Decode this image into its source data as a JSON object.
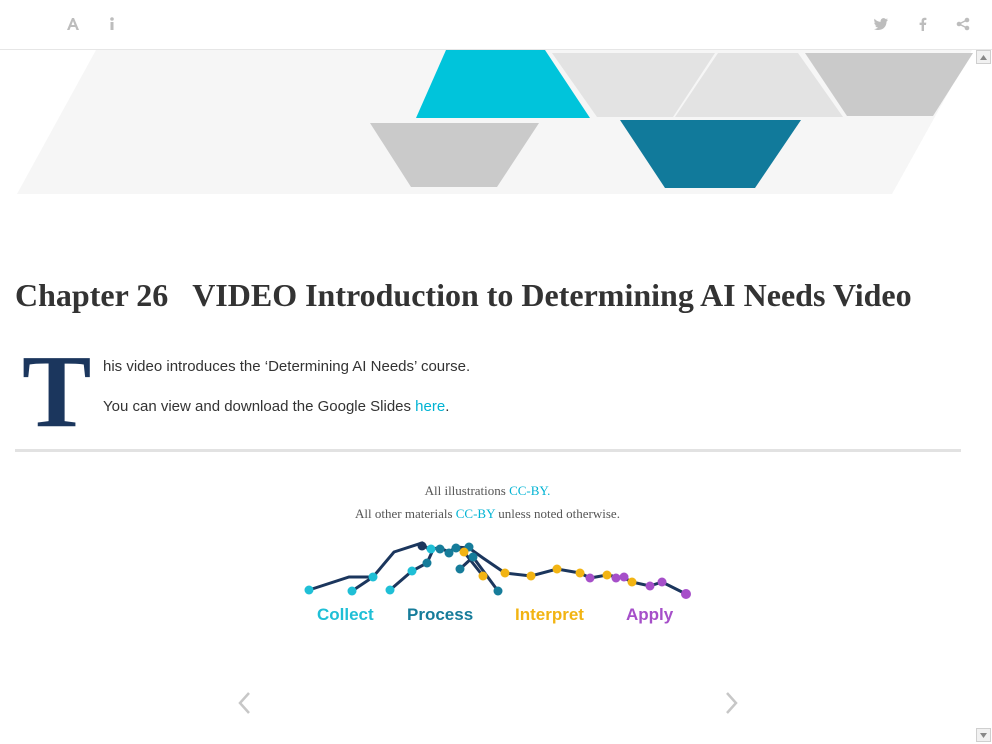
{
  "toolbar": {
    "left_icons": [
      "font-settings-icon",
      "info-icon"
    ],
    "right_icons": [
      "twitter-icon",
      "facebook-icon",
      "share-icon"
    ]
  },
  "chapter": {
    "number": "Chapter 26",
    "title": "VIDEO Introduction to Determining AI Needs Video"
  },
  "body": {
    "dropcap": "T",
    "para1": "his video introduces the ‘Determining AI Needs’ course.",
    "para2_prefix": "You can view and download the Google Slides ",
    "para2_link": "here",
    "para2_suffix": "."
  },
  "footer": {
    "line1_prefix": "All illustrations ",
    "line1_link": "CC-BY.",
    "line2_prefix": "All other materials ",
    "line2_link": "CC-BY",
    "line2_suffix": " unless noted otherwise."
  },
  "logo": {
    "labels": [
      "Collect",
      "Process",
      "Interpret",
      "Apply"
    ],
    "colors": {
      "collect": "#1fbfd6",
      "process": "#167c9a",
      "interpret": "#f2b413",
      "apply": "#a64fc9",
      "line": "#1b365d"
    }
  },
  "colors": {
    "accent": "#00b3d3",
    "dropcap": "#1b365d",
    "icon": "#bdbdbd"
  }
}
